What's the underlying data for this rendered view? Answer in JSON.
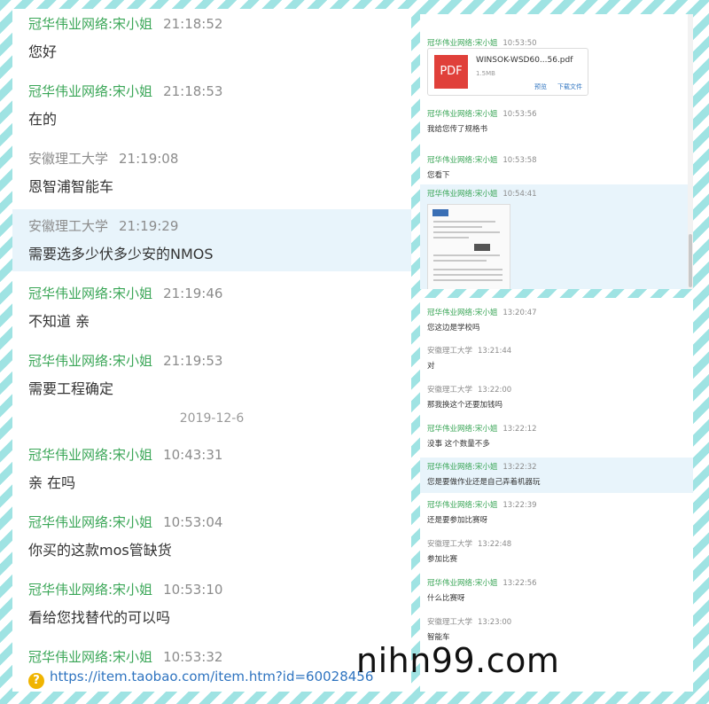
{
  "left_chat": {
    "messages": [
      {
        "sender": "冠华伟业网络:宋小姐",
        "time": "21:18:52",
        "text": "您好"
      },
      {
        "sender": "冠华伟业网络:宋小姐",
        "time": "21:18:53",
        "text": "在的"
      },
      {
        "sender": "安徽理工大学",
        "time": "21:19:08",
        "text": "恩智浦智能车"
      },
      {
        "sender": "安徽理工大学",
        "time": "21:19:29",
        "text": "需要选多少伏多少安的NMOS"
      },
      {
        "sender": "冠华伟业网络:宋小姐",
        "time": "21:19:46",
        "text": "不知道 亲"
      },
      {
        "sender": "冠华伟业网络:宋小姐",
        "time": "21:19:53",
        "text": "需要工程确定"
      },
      {
        "sender": "冠华伟业网络:宋小姐",
        "time": "10:43:31",
        "text": "亲 在吗"
      },
      {
        "sender": "冠华伟业网络:宋小姐",
        "time": "10:53:04",
        "text": "你买的这款mos管缺货"
      },
      {
        "sender": "冠华伟业网络:宋小姐",
        "time": "10:53:10",
        "text": "看给您找替代的可以吗"
      },
      {
        "sender": "冠华伟业网络:宋小姐",
        "time": "10:53:32",
        "text": ""
      }
    ],
    "date_separator": "2019-12-6",
    "link_text": "https://item.taobao.com/item.htm?id=60028456"
  },
  "right_top": {
    "file_message": {
      "sender": "冠华伟业网络:宋小姐",
      "time": "10:53:50"
    },
    "file": {
      "icon_label": "PDF",
      "name": "WINSOK-WSD60...56.pdf",
      "size": "1.5MB",
      "action_preview": "预览",
      "action_download": "下载文件"
    },
    "messages": [
      {
        "sender": "冠华伟业网络:宋小姐",
        "time": "10:53:56",
        "text": "我给您传了规格书"
      },
      {
        "sender": "冠华伟业网络:宋小姐",
        "time": "10:53:58",
        "text": "您看下"
      },
      {
        "sender": "冠华伟业网络:宋小姐",
        "time": "10:54:41",
        "text": ""
      }
    ]
  },
  "right_bottom": {
    "messages": [
      {
        "sender": "冠华伟业网络:宋小姐",
        "time": "13:20:47",
        "text": "您这边是学校吗"
      },
      {
        "sender": "安徽理工大学",
        "time": "13:21:44",
        "text": "对"
      },
      {
        "sender": "安徽理工大学",
        "time": "13:22:00",
        "text": "那我换这个还要加钱吗"
      },
      {
        "sender": "冠华伟业网络:宋小姐",
        "time": "13:22:12",
        "text": "没事 这个数量不多"
      },
      {
        "sender": "冠华伟业网络:宋小姐",
        "time": "13:22:32",
        "text": "您是要做作业还是自己弄着机器玩"
      },
      {
        "sender": "冠华伟业网络:宋小姐",
        "time": "13:22:39",
        "text": "还是要参加比赛呀"
      },
      {
        "sender": "安徽理工大学",
        "time": "13:22:48",
        "text": "参加比赛"
      },
      {
        "sender": "冠华伟业网络:宋小姐",
        "time": "13:22:56",
        "text": "什么比赛呀"
      },
      {
        "sender": "安徽理工大学",
        "time": "13:23:00",
        "text": "智能车"
      }
    ]
  },
  "watermark": "nihn99.com",
  "colors": {
    "seller": "#3aa657",
    "buyer": "#8c8c8c",
    "highlight": "#e8f4fb",
    "border": "#9fe3e3"
  }
}
